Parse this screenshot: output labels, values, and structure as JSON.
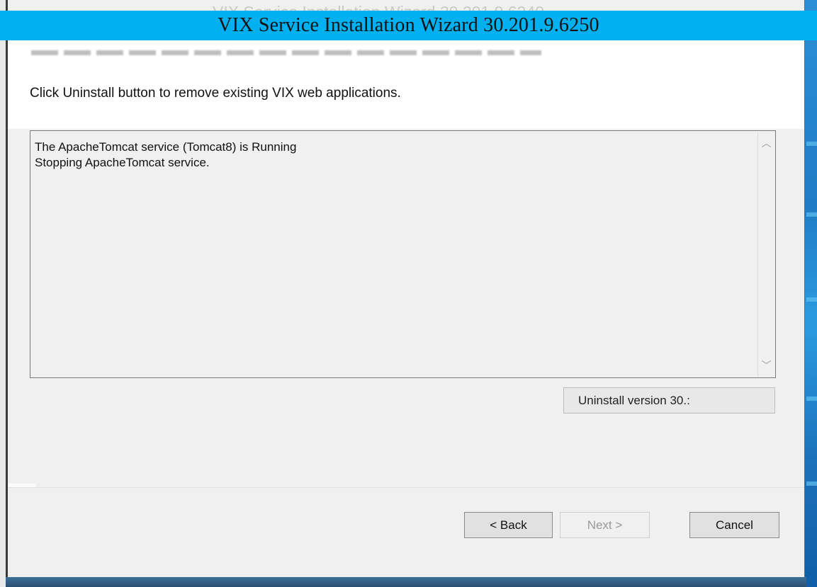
{
  "window": {
    "title": "VIX Service Installation Wizard 30.201.9.6250",
    "faded_title": "VIX Service Installation Wizard 30.201.9.6240"
  },
  "header": {
    "instruction": "Click Uninstall button to remove existing VIX web applications."
  },
  "log": {
    "lines": [
      "The ApacheTomcat service (Tomcat8) is Running",
      "Stopping ApacheTomcat service."
    ]
  },
  "scrollbar": {
    "up_icon": "chevron-up-icon",
    "down_icon": "chevron-down-icon",
    "up_glyph": "︿",
    "down_glyph": "﹀"
  },
  "buttons": {
    "uninstall_label": "Uninstall version 30.:",
    "back_label": "< Back",
    "next_label": "Next >",
    "cancel_label": "Cancel"
  },
  "colors": {
    "title_bar": "#00b0f0",
    "desktop": "#1f7cc4"
  }
}
